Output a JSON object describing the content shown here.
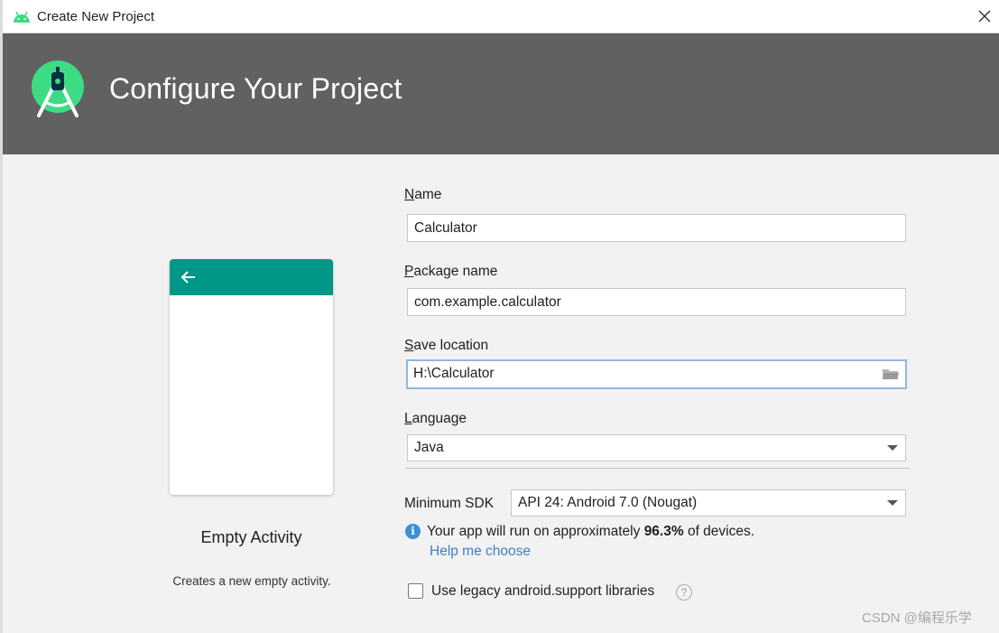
{
  "window": {
    "title": "Create New Project"
  },
  "banner": {
    "title": "Configure Your Project"
  },
  "template": {
    "name": "Empty Activity",
    "description": "Creates a new empty activity."
  },
  "form": {
    "name": {
      "label_first": "N",
      "label_rest": "ame",
      "value": "Calculator"
    },
    "package": {
      "label_first": "P",
      "label_rest": "ackage name",
      "value": "com.example.calculator"
    },
    "save_location": {
      "label_first": "S",
      "label_rest": "ave location",
      "value": "H:\\Calculator"
    },
    "language": {
      "label_first": "L",
      "label_rest": "anguage",
      "value": "Java"
    },
    "min_sdk": {
      "label": "Minimum SDK",
      "value": "API 24: Android 7.0 (Nougat)"
    },
    "info": {
      "prefix": "Your app will run on approximately ",
      "percent": "96.3%",
      "suffix": " of devices."
    },
    "help_link": "Help me choose",
    "legacy_checkbox": {
      "label": "Use legacy android.support libraries",
      "checked": false
    }
  },
  "watermark": "CSDN @编程乐学",
  "colors": {
    "banner": "#616161",
    "appbar": "#009688",
    "link": "#3d7fc4",
    "info": "#3d8fd6",
    "focus": "#8db8e6",
    "android_green": "#3ddc84"
  },
  "icons": {
    "app": "android-icon",
    "logo": "android-studio-logo",
    "close": "close-icon",
    "back": "arrow-back-icon",
    "folder": "folder-icon",
    "dropdown": "chevron-down-icon",
    "info": "info-icon",
    "help": "question-icon"
  }
}
